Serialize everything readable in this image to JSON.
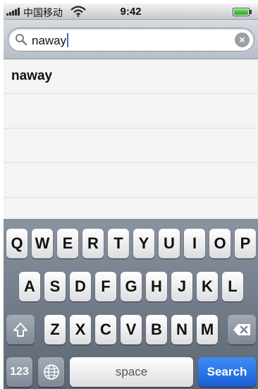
{
  "status_bar": {
    "carrier": "中国移动",
    "time": "9:42",
    "icons": [
      "signal-bars-icon",
      "wifi-icon",
      "battery-icon"
    ]
  },
  "search": {
    "query": "naway",
    "clear_icon": "×"
  },
  "results": [
    {
      "label": "naway"
    },
    {
      "label": ""
    },
    {
      "label": ""
    },
    {
      "label": ""
    }
  ],
  "keyboard": {
    "row1": [
      "Q",
      "W",
      "E",
      "R",
      "T",
      "Y",
      "U",
      "I",
      "O",
      "P"
    ],
    "row2": [
      "A",
      "S",
      "D",
      "F",
      "G",
      "H",
      "J",
      "K",
      "L"
    ],
    "row3": [
      "Z",
      "X",
      "C",
      "V",
      "B",
      "N",
      "M"
    ],
    "numbers_key": "123",
    "space_key": "space",
    "search_key": "Search"
  },
  "colors": {
    "search_key": "#1f6ae0",
    "caret": "#3a6bd9"
  }
}
